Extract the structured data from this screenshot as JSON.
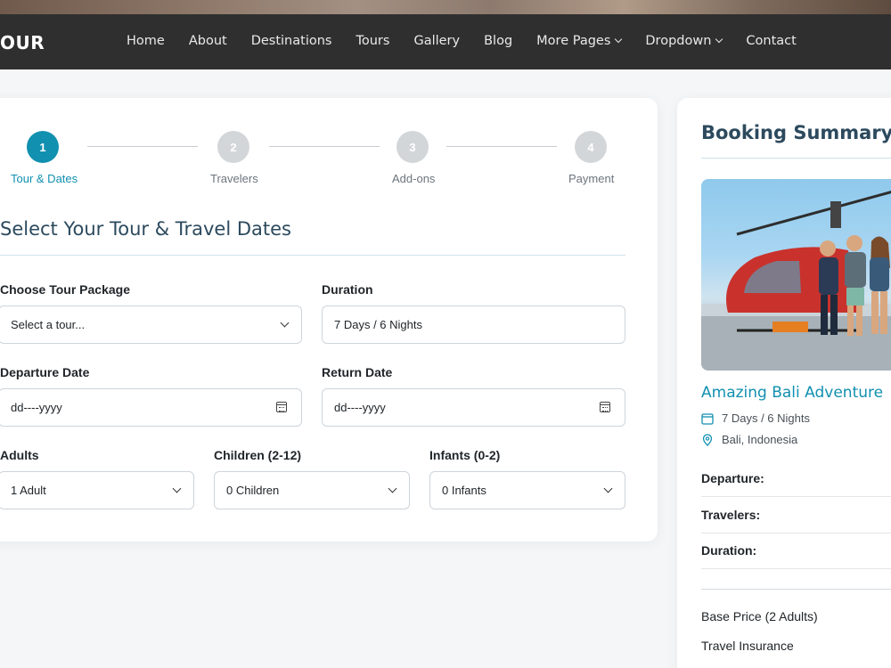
{
  "header": {
    "logo": "OUR",
    "nav": [
      {
        "label": "Home"
      },
      {
        "label": "About"
      },
      {
        "label": "Destinations"
      },
      {
        "label": "Tours"
      },
      {
        "label": "Gallery"
      },
      {
        "label": "Blog"
      },
      {
        "label": "More Pages",
        "dropdown": true
      },
      {
        "label": "Dropdown",
        "dropdown": true
      },
      {
        "label": "Contact"
      }
    ]
  },
  "steps": [
    {
      "num": "1",
      "label": "Tour & Dates",
      "active": true
    },
    {
      "num": "2",
      "label": "Travelers",
      "active": false
    },
    {
      "num": "3",
      "label": "Add-ons",
      "active": false
    },
    {
      "num": "4",
      "label": "Payment",
      "active": false
    }
  ],
  "form": {
    "title": "Select Your Tour & Travel Dates",
    "tour_package": {
      "label": "Choose Tour Package",
      "value": "Select a tour..."
    },
    "duration": {
      "label": "Duration",
      "value": "7 Days / 6 Nights"
    },
    "departure": {
      "label": "Departure Date",
      "value": "dd----yyyy"
    },
    "return": {
      "label": "Return Date",
      "value": "dd----yyyy"
    },
    "adults": {
      "label": "Adults",
      "value": "1 Adult"
    },
    "children": {
      "label": "Children (2-12)",
      "value": "0 Children"
    },
    "infants": {
      "label": "Infants (0-2)",
      "value": "0 Infants"
    }
  },
  "summary": {
    "title": "Booking Summary",
    "tour_name": "Amazing Bali Adventure",
    "duration": "7 Days / 6 Nights",
    "location": "Bali, Indonesia",
    "rows": [
      "Departure:",
      "Travelers:",
      "Duration:"
    ],
    "prices": [
      "Base Price (2 Adults)",
      "Travel Insurance"
    ]
  },
  "colors": {
    "accent": "#1190b0",
    "heading": "#2c4a5e",
    "nav_bg": "#2f2f2f"
  }
}
